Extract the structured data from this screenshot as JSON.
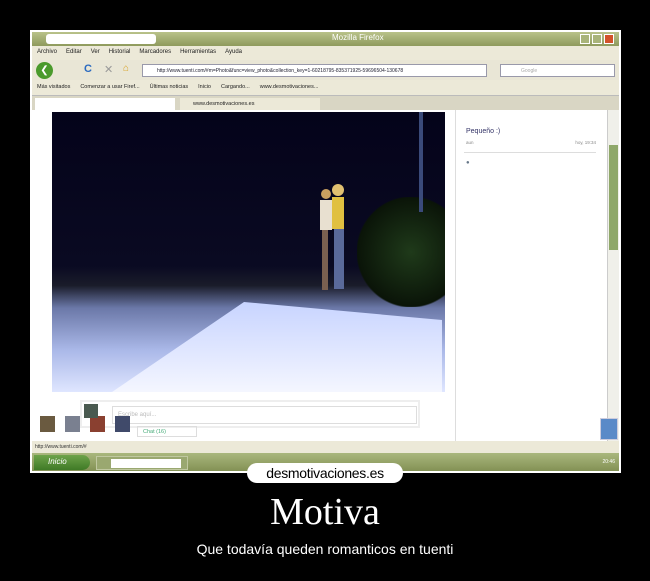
{
  "browser": {
    "window_title": "Mozilla Firefox",
    "menu": [
      "Archivo",
      "Editar",
      "Ver",
      "Historial",
      "Marcadores",
      "Herramientas",
      "Ayuda"
    ],
    "url": "http://www.tuenti.com/#m=Photo&func=view_photo&collection_key=1-60218795-835371925-59696504-130678",
    "search_placeholder": "Google",
    "bookmarks": [
      "Más visitados",
      "Comenzar a usar Firef...",
      "Últimas noticias",
      "Inicio",
      "Cargando...",
      "www.desmotivaciones..."
    ],
    "tab_active": "www.desmotivaciones.es",
    "status_url": "http://www.tuenti.com/#"
  },
  "page": {
    "comment_author": "Pequeño :)",
    "comment_meta_left": "aun",
    "comment_meta_right": "hoy, 19:34",
    "chat_placeholder": "Escribe aquí...",
    "chat_button": "Chat (16)"
  },
  "taskbar": {
    "start": "Inicio",
    "clock": "20:46"
  },
  "poster": {
    "logo": "desmotivaciones.es",
    "title": "Motiva",
    "subtitle": "Que todavía queden romanticos en tuenti"
  }
}
